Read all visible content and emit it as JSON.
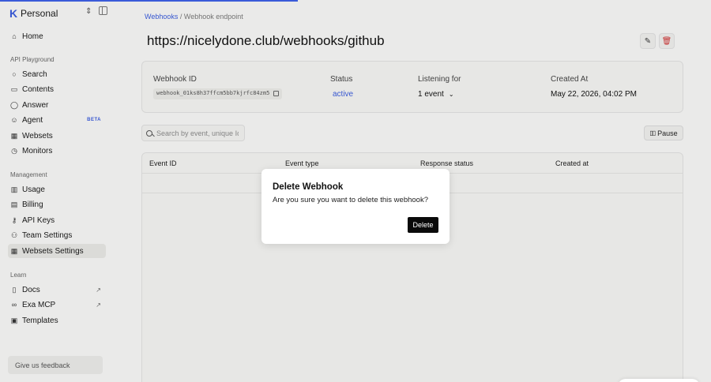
{
  "workspace": {
    "name": "Personal"
  },
  "sidebar": {
    "home": "Home",
    "sections": {
      "api_playground": "API Playground",
      "management": "Management",
      "learn": "Learn"
    },
    "playground_items": [
      {
        "label": "Search",
        "icon": "search-icon"
      },
      {
        "label": "Contents",
        "icon": "document-icon"
      },
      {
        "label": "Answer",
        "icon": "chat-icon"
      },
      {
        "label": "Agent",
        "icon": "agent-icon",
        "badge": "BETA"
      },
      {
        "label": "Websets",
        "icon": "table-icon"
      },
      {
        "label": "Monitors",
        "icon": "clock-icon"
      }
    ],
    "management_items": [
      {
        "label": "Usage",
        "icon": "chart-icon"
      },
      {
        "label": "Billing",
        "icon": "billing-icon"
      },
      {
        "label": "API Keys",
        "icon": "key-icon"
      },
      {
        "label": "Team Settings",
        "icon": "team-icon"
      },
      {
        "label": "Websets Settings",
        "icon": "table-icon"
      }
    ],
    "learn_items": [
      {
        "label": "Docs",
        "icon": "docs-icon"
      },
      {
        "label": "Exa MCP",
        "icon": "mcp-icon"
      },
      {
        "label": "Templates",
        "icon": "templates-icon"
      }
    ],
    "feedback": "Give us feedback"
  },
  "breadcrumb": {
    "parent": "Webhooks",
    "separator": "/",
    "current": "Webhook endpoint"
  },
  "page_title": "https://nicelydone.club/webhooks/github",
  "info": {
    "webhook_id_label": "Webhook ID",
    "webhook_id": "webhook_01ks8h37ffcm5bb7kjrfc84zm5",
    "status_label": "Status",
    "status": "active",
    "listening_label": "Listening for",
    "listening": "1 event",
    "created_label": "Created At",
    "created": "May 22, 2026, 04:02 PM"
  },
  "search": {
    "placeholder": "Search by event, unique Id, o"
  },
  "pause_label": "Pause",
  "table": {
    "columns": [
      "Event ID",
      "Event type",
      "Response status",
      "Created at"
    ]
  },
  "dialog": {
    "title": "Delete Webhook",
    "message": "Are you sure you want to delete this webhook?",
    "confirm": "Delete"
  },
  "colors": {
    "accent": "#3a5bd9",
    "danger": "#cc3333",
    "button_dark": "#0a0a0a"
  }
}
